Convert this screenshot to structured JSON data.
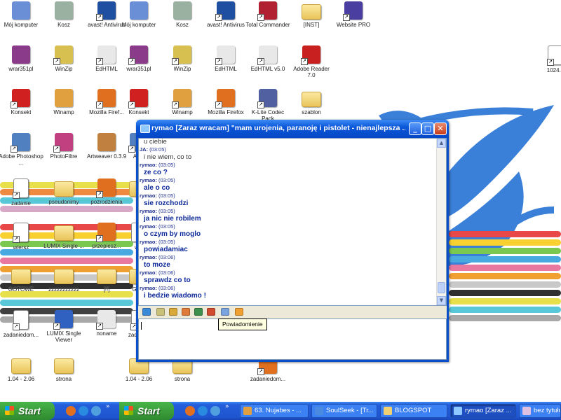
{
  "desktop_icons": [
    {
      "label": "Mój komputer",
      "kind": "computer-icon",
      "color": "#6b8fd6"
    },
    {
      "label": "Kosz",
      "kind": "recycle-bin-icon",
      "color": "#9ab0a0"
    },
    {
      "label": "avast! Antivirus",
      "kind": "avast-icon",
      "color": "#1f4fa0"
    },
    {
      "label": "Mój komputer",
      "kind": "computer-icon",
      "color": "#6b8fd6"
    },
    {
      "label": "Kosz",
      "kind": "recycle-bin-icon",
      "color": "#9ab0a0"
    },
    {
      "label": "avast! Antivirus",
      "kind": "avast-icon",
      "color": "#1f4fa0"
    },
    {
      "label": "Total Commander",
      "kind": "floppy-icon",
      "color": "#b02030"
    },
    {
      "label": "[INST]",
      "kind": "folder-icon",
      "color": "#f0d070"
    },
    {
      "label": "Website PRO",
      "kind": "website-pro-icon",
      "color": "#4a3fa0"
    },
    {
      "label": "wrar351pl",
      "kind": "winrar-icon",
      "color": "#8a3c8a"
    },
    {
      "label": "WinZip",
      "kind": "winzip-icon",
      "color": "#d8c050"
    },
    {
      "label": "EdHTML",
      "kind": "edhtml-icon",
      "color": "#e8e8e8"
    },
    {
      "label": "wrar351pl",
      "kind": "winrar-icon",
      "color": "#8a3c8a"
    },
    {
      "label": "WinZip",
      "kind": "winzip-icon",
      "color": "#d8c050"
    },
    {
      "label": "EdHTML",
      "kind": "edhtml-icon",
      "color": "#e8e8e8"
    },
    {
      "label": "EdHTML v5.0",
      "kind": "edhtml-icon",
      "color": "#e8e8e8"
    },
    {
      "label": "Adobe Reader 7.0",
      "kind": "adobe-reader-icon",
      "color": "#c82020"
    },
    {
      "label": "Konsekt",
      "kind": "konsekt-icon",
      "color": "#d02020"
    },
    {
      "label": "Winamp",
      "kind": "winamp-icon",
      "color": "#e0a040"
    },
    {
      "label": "Mozilla Firef...",
      "kind": "firefox-icon",
      "color": "#e07020"
    },
    {
      "label": "Konsekt",
      "kind": "konsekt-icon",
      "color": "#d02020"
    },
    {
      "label": "Winamp",
      "kind": "winamp-icon",
      "color": "#e0a040"
    },
    {
      "label": "Mozilla Firefox",
      "kind": "firefox-icon",
      "color": "#e07020"
    },
    {
      "label": "K-Lite Codec Pack",
      "kind": "klite-icon",
      "color": "#5060a0"
    },
    {
      "label": "szablon",
      "kind": "folder-icon",
      "color": "#f0d070"
    },
    {
      "label": "Adobe Photoshop ...",
      "kind": "photoshop-icon",
      "color": "#5080c0"
    },
    {
      "label": "PhotoFiltre",
      "kind": "photofiltre-icon",
      "color": "#c04080"
    },
    {
      "label": "Artweaver 0.3.9",
      "kind": "artweaver-icon",
      "color": "#c08040"
    },
    {
      "label": "Ad...",
      "kind": "photoshop-icon",
      "color": "#5080c0"
    },
    {
      "label": "zadanie",
      "kind": "document-icon",
      "color": "#ffffff"
    },
    {
      "label": "pseudonimy",
      "kind": "folder-icon",
      "color": "#f0d070"
    },
    {
      "label": "pozrodzienia",
      "kind": "firefox-icon",
      "color": "#e07020"
    },
    {
      "label": "",
      "kind": "folder-icon",
      "color": "#f0d070"
    },
    {
      "label": "wiersz",
      "kind": "document-icon",
      "color": "#ffffff"
    },
    {
      "label": "LUMIX Single ...",
      "kind": "folder-icon",
      "color": "#f0d070"
    },
    {
      "label": "przepiesz...",
      "kind": "firefox-icon",
      "color": "#e07020"
    },
    {
      "label": "w...",
      "kind": "document-icon",
      "color": "#ffffff"
    },
    {
      "label": "GOTOWE",
      "kind": "folder-icon",
      "color": "#f0d070"
    },
    {
      "label": "zzzzzzzzzzz",
      "kind": "folder-icon",
      "color": "#f0d070"
    },
    {
      "label": "[!!]",
      "kind": "folder-icon",
      "color": "#f0d070"
    },
    {
      "label": "GO...",
      "kind": "folder-icon",
      "color": "#f0d070"
    },
    {
      "label": "zadaniedom...",
      "kind": "document-icon",
      "color": "#ffffff"
    },
    {
      "label": "LUMIX Single Viewer",
      "kind": "lumix-icon",
      "color": "#3060c0"
    },
    {
      "label": "noname",
      "kind": "calendar-icon",
      "color": "#e8e8e8"
    },
    {
      "label": "zadani...",
      "kind": "document-icon",
      "color": "#ffffff"
    },
    {
      "label": "1.04 - 2.06",
      "kind": "folder-icon",
      "color": "#f0d070"
    },
    {
      "label": "strona",
      "kind": "folder-icon",
      "color": "#f0d070"
    },
    {
      "label": "1.04 - 2.06",
      "kind": "folder-icon",
      "color": "#f0d070"
    },
    {
      "label": "strona",
      "kind": "folder-icon",
      "color": "#f0d070"
    },
    {
      "label": "zadaniedom...",
      "kind": "firefox-icon",
      "color": "#e07020"
    },
    {
      "label": "1024...",
      "kind": "document-icon",
      "color": "#ffffff"
    }
  ],
  "chat": {
    "title": "rymao [Zaraz wracam] \"mam urojenia, paranoję i pistolet - nienajlepsza ...",
    "controls": {
      "minimize": "_",
      "maximize": "□",
      "close": "✕"
    },
    "first_line": "u ciebie",
    "messages": [
      {
        "sender": "JA:",
        "time": "(03:05)",
        "text": "i nie wiem, co to",
        "plain": true
      },
      {
        "sender": "rymao:",
        "time": "(03:05)",
        "text": "ze co ?",
        "plain": false
      },
      {
        "sender": "rymao:",
        "time": "(03:05)",
        "text": "ale o co",
        "plain": false
      },
      {
        "sender": "rymao:",
        "time": "(03:05)",
        "text": "sie rozchodzi",
        "plain": false
      },
      {
        "sender": "rymao:",
        "time": "(03:05)",
        "text": "ja nic nie robilem",
        "plain": false
      },
      {
        "sender": "rymao:",
        "time": "(03:05)",
        "text": "o czym by moglo",
        "plain": false
      },
      {
        "sender": "rymao:",
        "time": "(03:05)",
        "text": "powiadamiac",
        "plain": false
      },
      {
        "sender": "rymao:",
        "time": "(03:06)",
        "text": "to moze",
        "plain": false
      },
      {
        "sender": "rymao:",
        "time": "(03:06)",
        "text": "sprawdz co to",
        "plain": false
      },
      {
        "sender": "rymao:",
        "time": "(03:06)",
        "text": "i bedzie wiadomo !",
        "plain": false
      }
    ],
    "toolbar": [
      {
        "name": "send-file-icon",
        "color": "#3b8ad8"
      },
      {
        "name": "contact-card-icon",
        "color": "#c9c17a"
      },
      {
        "name": "emoticon-icon",
        "color": "#d8a838"
      },
      {
        "name": "image-icon",
        "color": "#e07c3a"
      },
      {
        "name": "sound-icon",
        "color": "#3c8f4c"
      },
      {
        "name": "history-icon",
        "color": "#d04a30"
      },
      {
        "name": "notify-icon",
        "color": "#7aa3e0"
      },
      {
        "name": "envelope-icon",
        "color": "#f0a030"
      }
    ],
    "tooltip": "Powiadomienie"
  },
  "taskbar": {
    "start_label": "Start",
    "tasks": [
      {
        "label": "63. Nujabes - ...",
        "color": "#e0a040",
        "active": false
      },
      {
        "label": "SoulSeek - [Tr...",
        "color": "#4a8ae0",
        "active": false
      },
      {
        "label": "BLOGSPOT",
        "color": "#f0d070",
        "active": false
      },
      {
        "label": "rymao [Zaraz ...",
        "color": "#8fc8ff",
        "active": true
      },
      {
        "label": "bez tytułu",
        "color": "#e0c0e0",
        "active": false
      }
    ]
  }
}
